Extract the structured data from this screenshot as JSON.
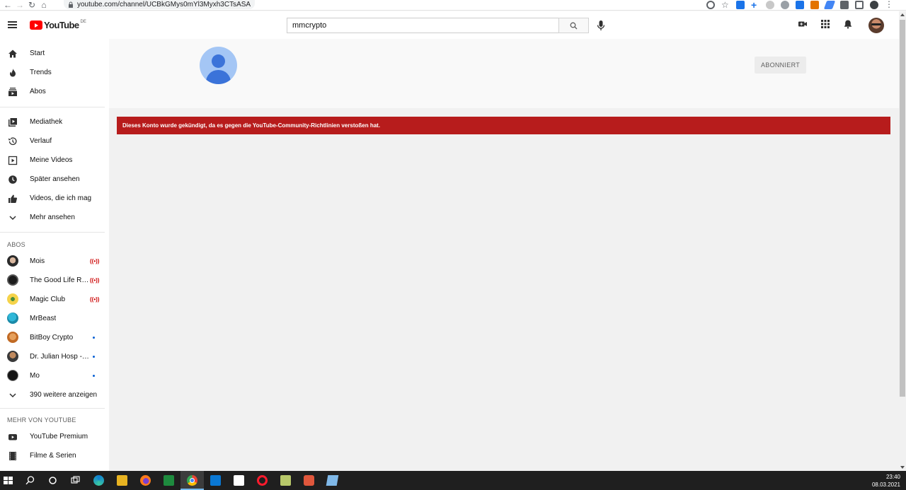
{
  "browser": {
    "url": "youtube.com/channel/UCBkGMys0mYl3Myxh3CTsASA"
  },
  "header": {
    "logo_text": "YouTube",
    "logo_country": "DE",
    "search_value": "mmcrypto"
  },
  "sidebar": {
    "main_items": [
      {
        "label": "Start",
        "icon": "home-icon"
      },
      {
        "label": "Trends",
        "icon": "fire-icon"
      },
      {
        "label": "Abos",
        "icon": "subscriptions-icon"
      }
    ],
    "library_items": [
      {
        "label": "Mediathek",
        "icon": "library-icon"
      },
      {
        "label": "Verlauf",
        "icon": "history-icon"
      },
      {
        "label": "Meine Videos",
        "icon": "my-videos-icon"
      },
      {
        "label": "Später ansehen",
        "icon": "watch-later-icon"
      },
      {
        "label": "Videos, die ich mag",
        "icon": "thumbs-up-icon"
      },
      {
        "label": "Mehr ansehen",
        "icon": "chevron-down-icon"
      }
    ],
    "abos_heading": "ABOS",
    "subscriptions": [
      {
        "label": "Mois",
        "status": "live"
      },
      {
        "label": "The Good Life Radio",
        "status": "live"
      },
      {
        "label": "Magic Club",
        "status": "live"
      },
      {
        "label": "MrBeast",
        "status": "none"
      },
      {
        "label": "BitBoy Crypto",
        "status": "new"
      },
      {
        "label": "Dr. Julian Hosp - Bitcoin",
        "status": "new"
      },
      {
        "label": "Mo",
        "status": "new"
      }
    ],
    "show_more": "390 weitere anzeigen",
    "more_heading": "MEHR VON YOUTUBE",
    "more_items": [
      {
        "label": "YouTube Premium",
        "icon": "youtube-icon"
      },
      {
        "label": "Filme & Serien",
        "icon": "film-icon"
      }
    ]
  },
  "channel": {
    "subscribe_label": "ABONNIERT",
    "alert_text": "Dieses Konto wurde gekündigt, da es gegen die YouTube-Community-Richtlinien verstoßen hat."
  },
  "taskbar": {
    "time": "23:40",
    "date": "08.03.2021"
  },
  "colors": {
    "brand_red": "#ff0000",
    "alert_bg": "#b71c1c",
    "live_red": "#cc0000",
    "new_dot": "#065fd4"
  }
}
